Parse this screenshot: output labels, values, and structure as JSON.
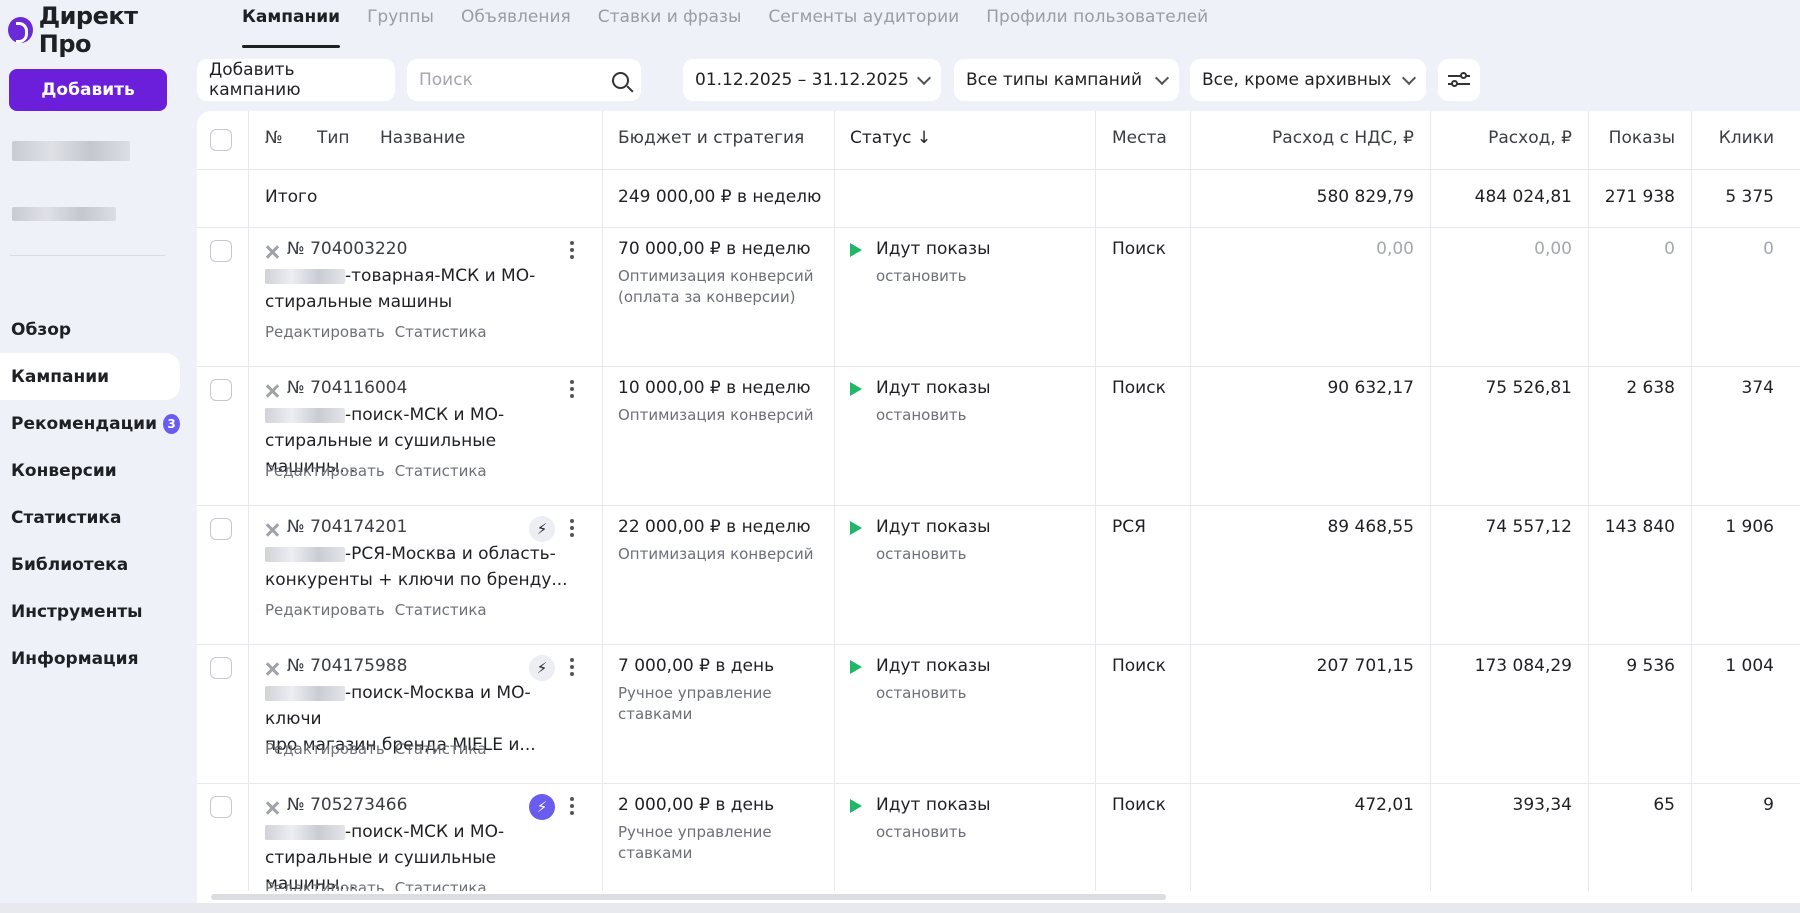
{
  "app": {
    "logo_text": "Директ Про",
    "add_button": "Добавить",
    "accent_color": "#6b1fdb",
    "status_color": "#1fb86b"
  },
  "sidebar": {
    "nav": [
      {
        "label": "Обзор"
      },
      {
        "label": "Кампании",
        "active": true
      },
      {
        "label": "Рекомендации",
        "badge": "3"
      },
      {
        "label": "Конверсии"
      },
      {
        "label": "Статистика"
      },
      {
        "label": "Библиотека"
      },
      {
        "label": "Инструменты"
      },
      {
        "label": "Информация"
      }
    ]
  },
  "tabs": [
    "Кампании",
    "Группы",
    "Объявления",
    "Ставки и фразы",
    "Сегменты аудитории",
    "Профили пользователей"
  ],
  "toolbar": {
    "add_campaign": "Добавить кампанию",
    "search_placeholder": "Поиск",
    "date_range": "01.12.2025 – 31.12.2025",
    "type_filter": "Все типы кампаний",
    "archive_filter": "Все, кроме архивных"
  },
  "table": {
    "headers": {
      "num": "№",
      "type": "Тип",
      "name": "Название",
      "budget": "Бюджет и стратегия",
      "status": "Статус ↓",
      "places": "Места",
      "spend_vat": "Расход с НДС, ₽",
      "spend": "Расход, ₽",
      "impressions": "Показы",
      "clicks": "Клики"
    },
    "total": {
      "label": "Итого",
      "budget": "249 000,00 ₽ в неделю",
      "spend_vat": "580 829,79",
      "spend": "484 024,81",
      "impressions": "271 938",
      "clicks": "5 375"
    },
    "links": {
      "edit": "Редактировать",
      "stats": "Статистика"
    },
    "rows": [
      {
        "id": "№ 704003220",
        "name_line1": "-товарная-МСК и МО-",
        "name_line2": "стиральные машины",
        "budget": "70 000,00 ₽ в неделю",
        "strategy": "Оптимизация конверсий (оплата за конверсии)",
        "status": "Идут показы",
        "stop": "остановить",
        "place": "Поиск",
        "spend_vat": "0,00",
        "spend": "0,00",
        "impressions": "0",
        "clicks": "0",
        "zero": true
      },
      {
        "id": "№ 704116004",
        "name_line1": "-поиск-МСК и МО-",
        "name_line2": "стиральные и сушильные машины...",
        "budget": "10 000,00 ₽ в неделю",
        "strategy": "Оптимизация конверсий",
        "status": "Идут показы",
        "stop": "остановить",
        "place": "Поиск",
        "spend_vat": "90 632,17",
        "spend": "75 526,81",
        "impressions": "2 638",
        "clicks": "374"
      },
      {
        "id": "№ 704174201",
        "name_line1": "-РСЯ-Москва и область-",
        "name_line2": "конкуренты + ключи по бренду...",
        "budget": "22 000,00 ₽ в неделю",
        "strategy": "Оптимизация конверсий",
        "status": "Идут показы",
        "stop": "остановить",
        "place": "РСЯ",
        "spend_vat": "89 468,55",
        "spend": "74 557,12",
        "impressions": "143 840",
        "clicks": "1 906",
        "bolt": true
      },
      {
        "id": "№ 704175988",
        "name_line1": "-поиск-Москва и МО-ключи",
        "name_line2": "про магазин бренда MIELE и...",
        "budget": "7 000,00 ₽ в день",
        "strategy": "Ручное управление ставками",
        "status": "Идут показы",
        "stop": "остановить",
        "place": "Поиск",
        "spend_vat": "207 701,15",
        "spend": "173 084,29",
        "impressions": "9 536",
        "clicks": "1 004",
        "bolt": true
      },
      {
        "id": "№ 705273466",
        "name_line1": "-поиск-МСК и МО-",
        "name_line2": "стиральные и сушильные машины...",
        "budget": "2 000,00 ₽ в день",
        "strategy": "Ручное управление ставками",
        "status": "Идут показы",
        "stop": "остановить",
        "place": "Поиск",
        "spend_vat": "472,01",
        "spend": "393,34",
        "impressions": "65",
        "clicks": "9",
        "bolt_active": true
      }
    ]
  }
}
